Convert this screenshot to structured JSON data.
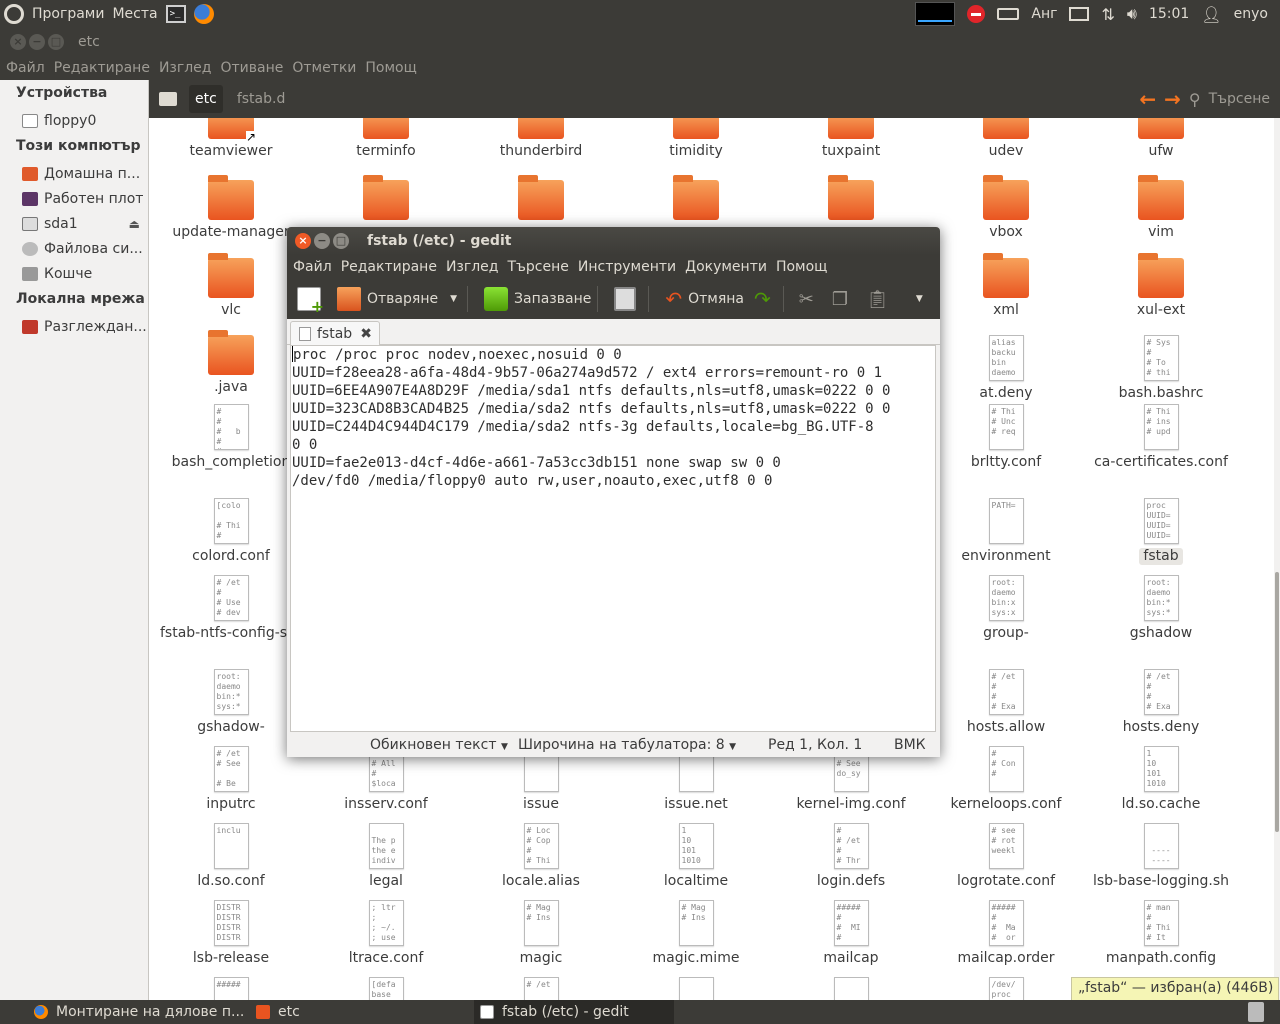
{
  "top_panel": {
    "menu_programs": "Програми",
    "menu_places": "Места",
    "keyboard_layout": "Анг",
    "clock": "15:01",
    "user": "enyo"
  },
  "nautilus": {
    "window_title": "etc",
    "menu": [
      "Файл",
      "Редактиране",
      "Изглед",
      "Отиване",
      "Отметки",
      "Помощ"
    ],
    "sidebar": {
      "devices_header": "Устройства",
      "devices": [
        {
          "label": "floppy0",
          "icon": "floppy-icon"
        }
      ],
      "computer_header": "Този компютър",
      "computer": [
        {
          "label": "Домашна п...",
          "icon": "home-icon"
        },
        {
          "label": "Работен плот",
          "icon": "desktop-icon"
        },
        {
          "label": "sda1",
          "icon": "drive-icon"
        },
        {
          "label": "Файлова си...",
          "icon": "filesystem-icon"
        },
        {
          "label": "Кошче",
          "icon": "trash-icon"
        }
      ],
      "network_header": "Локална мрежа",
      "network": [
        {
          "label": "Разглеждан...",
          "icon": "network-icon"
        }
      ]
    },
    "path": {
      "current": "etc",
      "next": "fstab.d",
      "search_label": "Търсене"
    },
    "files": [
      {
        "name": "teamviewer",
        "type": "folder-link"
      },
      {
        "name": "terminfo",
        "type": "folder"
      },
      {
        "name": "thunderbird",
        "type": "folder"
      },
      {
        "name": "timidity",
        "type": "folder"
      },
      {
        "name": "tuxpaint",
        "type": "folder"
      },
      {
        "name": "udev",
        "type": "folder"
      },
      {
        "name": "ufw",
        "type": "folder"
      },
      {
        "name": "update-manager",
        "type": "folder"
      },
      {
        "name": "",
        "type": "folder"
      },
      {
        "name": "",
        "type": "folder"
      },
      {
        "name": "",
        "type": "folder"
      },
      {
        "name": "",
        "type": "folder"
      },
      {
        "name": "vbox",
        "type": "folder"
      },
      {
        "name": "vim",
        "type": "folder"
      },
      {
        "name": "vlc",
        "type": "folder"
      },
      {
        "name": "xml",
        "type": "folder"
      },
      {
        "name": "xul-ext",
        "type": "folder"
      },
      {
        "name": ".java",
        "type": "folder"
      },
      {
        "name": "at.deny",
        "type": "doc",
        "preview": "alias\nbacku\nbin\ndaemo"
      },
      {
        "name": "bash.bashrc",
        "type": "doc",
        "preview": "# Sys\n#\n# To\n# thi"
      },
      {
        "name": "bash_completion",
        "type": "doc",
        "preview": "#\n#\n#   b\n#\n#   c"
      },
      {
        "name": "brltty.conf",
        "type": "doc",
        "preview": "# Thi\n# Unc\n# req"
      },
      {
        "name": "ca-certificates.conf",
        "type": "doc",
        "preview": "# Thi\n# ins\n# upd"
      },
      {
        "name": "colord.conf",
        "type": "doc",
        "preview": "[colo\n\n# Thi\n#"
      },
      {
        "name": "environment",
        "type": "doc",
        "preview": "PATH="
      },
      {
        "name": "fstab",
        "type": "doc",
        "preview": "proc\nUUID=\nUUID=\nUUID=",
        "selected": true
      },
      {
        "name": "fstab-ntfs-config-save",
        "type": "doc",
        "preview": "# /et\n#\n# Use\n# dev"
      },
      {
        "name": "group-",
        "type": "doc",
        "preview": "root:\ndaemo\nbin:x\nsys:x"
      },
      {
        "name": "gshadow",
        "type": "doc",
        "preview": "root:\ndaemo\nbin:*\nsys:*"
      },
      {
        "name": "gshadow-",
        "type": "doc",
        "preview": "root:\ndaemo\nbin:*\nsys:*"
      },
      {
        "name": "hosts.allow",
        "type": "doc",
        "preview": "# /et\n#\n#\n# Exa"
      },
      {
        "name": "hosts.deny",
        "type": "doc",
        "preview": "# /et\n#\n#\n# Exa"
      },
      {
        "name": "inputrc",
        "type": "doc",
        "preview": "# /et\n# See\n\n# Be"
      },
      {
        "name": "insserv.conf",
        "type": "doc",
        "preview": "#\n# All\n#\n$loca"
      },
      {
        "name": "issue",
        "type": "doc",
        "preview": "Ubunt"
      },
      {
        "name": "issue.net",
        "type": "doc",
        "preview": "Ubunt"
      },
      {
        "name": "kernel-img.conf",
        "type": "doc",
        "preview": "# Ker\n# See\ndo_sy"
      },
      {
        "name": "kerneloops.conf",
        "type": "doc",
        "preview": "#\n# Con\n#"
      },
      {
        "name": "ld.so.cache",
        "type": "doc",
        "preview": "1\n10\n101\n1010"
      },
      {
        "name": "ld.so.conf",
        "type": "doc",
        "preview": "inclu"
      },
      {
        "name": "legal",
        "type": "doc",
        "preview": "\nThe p\nthe e\nindiv"
      },
      {
        "name": "locale.alias",
        "type": "doc",
        "preview": "# Loc\n# Cop\n#\n# Thi"
      },
      {
        "name": "localtime",
        "type": "doc",
        "preview": "1\n10\n101\n1010"
      },
      {
        "name": "login.defs",
        "type": "doc",
        "preview": "#\n# /et\n#\n# Thr"
      },
      {
        "name": "logrotate.conf",
        "type": "doc",
        "preview": "# see\n# rot\nweekl"
      },
      {
        "name": "lsb-base-logging.sh",
        "type": "doc",
        "preview": "\n\n ----\n ----"
      },
      {
        "name": "lsb-release",
        "type": "doc",
        "preview": "DISTR\nDISTR\nDISTR\nDISTR"
      },
      {
        "name": "ltrace.conf",
        "type": "doc",
        "preview": "; ltr\n;\n; ~/.\n; use"
      },
      {
        "name": "magic",
        "type": "doc",
        "preview": "# Mag\n# Ins"
      },
      {
        "name": "magic.mime",
        "type": "doc",
        "preview": "# Mag\n# Ins"
      },
      {
        "name": "mailcap",
        "type": "doc",
        "preview": "#####\n#\n#  MI\n#"
      },
      {
        "name": "mailcap.order",
        "type": "doc",
        "preview": "#####\n#\n#  Ma\n#  or"
      },
      {
        "name": "manpath.config",
        "type": "doc",
        "preview": "# man\n#\n# Thi\n# It"
      },
      {
        "name": "",
        "type": "doc",
        "preview": "#####"
      },
      {
        "name": "",
        "type": "doc",
        "preview": "[defa\nbase"
      },
      {
        "name": "",
        "type": "doc",
        "preview": "# /et"
      },
      {
        "name": "",
        "type": "doc",
        "preview": ""
      },
      {
        "name": "",
        "type": "doc",
        "preview": ""
      },
      {
        "name": "",
        "type": "doc",
        "preview": "/dev/\nproc"
      },
      {
        "name": "",
        "type": "doc",
        "preview": ""
      }
    ],
    "selection_status": "„fstab“ — избран(а) (446B)"
  },
  "gedit": {
    "window_title": "fstab (/etc) - gedit",
    "menu": [
      "Файл",
      "Редактиране",
      "Изглед",
      "Търсене",
      "Инструменти",
      "Документи",
      "Помощ"
    ],
    "toolbar": {
      "open_label": "Отваряне",
      "save_label": "Запазване",
      "undo_label": "Отмяна"
    },
    "tab_label": "fstab",
    "content": [
      "proc /proc proc nodev,noexec,nosuid 0 0",
      "UUID=f28eea28-a6fa-48d4-9b57-06a274a9d572 / ext4 errors=remount-ro 0 1",
      "UUID=6EE4A907E4A8D29F /media/sda1 ntfs defaults,nls=utf8,umask=0222 0 0",
      "UUID=323CAD8B3CAD4B25 /media/sda2 ntfs defaults,nls=utf8,umask=0222 0 0",
      "UUID=C244D4C944D4C179 /media/sda2 ntfs-3g defaults,locale=bg_BG.UTF-8",
      "0 0",
      "UUID=fae2e013-d4cf-4d6e-a661-7a53cc3db151 none swap sw 0 0",
      "/dev/fd0 /media/floppy0 auto rw,user,noauto,exec,utf8 0 0"
    ],
    "status": {
      "syntax": "Обикновен текст",
      "tab_width": "Широчина на табулатора:  8",
      "position": "Ред 1, Кол. 1",
      "mode": "ВМК"
    }
  },
  "taskbar": [
    {
      "label": "Монтиране на дялове п...",
      "icon": "firefox-icon"
    },
    {
      "label": "etc",
      "icon": "folder-icon"
    },
    {
      "label": "fstab (/etc) - gedit",
      "icon": "gedit-icon",
      "active": true
    }
  ]
}
